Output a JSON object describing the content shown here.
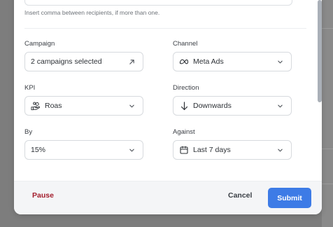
{
  "recipients": {
    "hint": "Insert comma between recipients, if more than one."
  },
  "campaign": {
    "label": "Campaign",
    "value": "2 campaigns selected",
    "trail_icon": "arrow-up-right-icon"
  },
  "channel": {
    "label": "Channel",
    "value": "Meta Ads",
    "lead_icon": "meta-icon",
    "trail_icon": "chevron-down-icon"
  },
  "kpi": {
    "label": "KPI",
    "value": "Roas",
    "lead_icon": "hand-coins-icon",
    "trail_icon": "chevron-down-icon"
  },
  "direction": {
    "label": "Direction",
    "value": "Downwards",
    "lead_icon": "arrow-down-icon",
    "trail_icon": "chevron-down-icon"
  },
  "by": {
    "label": "By",
    "value": "15%",
    "trail_icon": "chevron-down-icon"
  },
  "against": {
    "label": "Against",
    "value": "Last 7 days",
    "lead_icon": "calendar-icon",
    "trail_icon": "chevron-down-icon"
  },
  "footer": {
    "pause_label": "Pause",
    "cancel_label": "Cancel",
    "submit_label": "Submit"
  },
  "colors": {
    "pause": "#a31d2c",
    "submit_bg": "#3d7be6",
    "submit_text": "#ffffff"
  }
}
